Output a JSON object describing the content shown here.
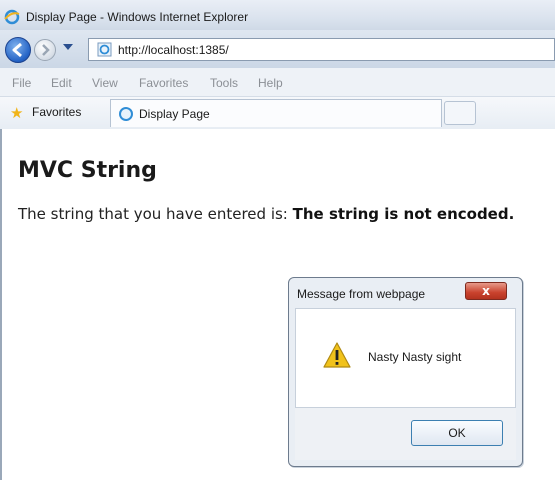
{
  "window": {
    "title": "Display Page - Windows Internet Explorer",
    "app_icon": "internet-explorer-icon"
  },
  "nav": {
    "back_icon": "back-arrow-icon",
    "forward_icon": "forward-arrow-icon",
    "address": "http://localhost:1385/"
  },
  "menu": {
    "items": [
      "File",
      "Edit",
      "View",
      "Favorites",
      "Tools",
      "Help"
    ]
  },
  "favorites_bar": {
    "favorites_label": "Favorites",
    "tab_label": "Display Page"
  },
  "page": {
    "heading": "MVC String",
    "intro_text": "The string that you have entered is: ",
    "entered_string": "The string is not encoded."
  },
  "dialog": {
    "title": "Message from webpage",
    "close_label": "x",
    "message": "Nasty Nasty sight",
    "ok_label": "OK",
    "icon": "warning-icon"
  },
  "colors": {
    "accent": "#2362c5",
    "close_button": "#c9422d",
    "warning": "#f1c21b"
  }
}
